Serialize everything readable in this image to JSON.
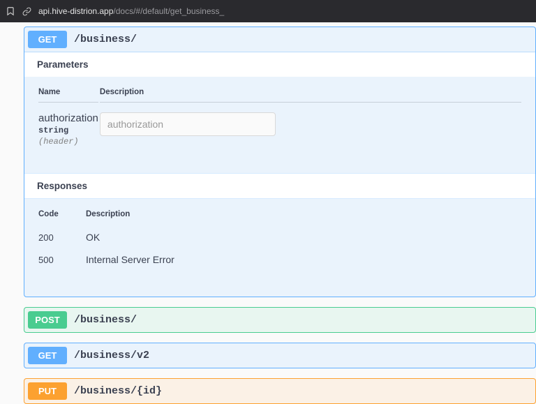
{
  "browser": {
    "url_host": "api.hive-distrion.app",
    "url_path": "/docs/#/default/get_business_"
  },
  "endpoints": {
    "get_business": {
      "method": "GET",
      "path": "/business/"
    },
    "post_business": {
      "method": "POST",
      "path": "/business/"
    },
    "get_business_v2": {
      "method": "GET",
      "path": "/business/v2"
    },
    "put_business_id": {
      "method": "PUT",
      "path": "/business/{id}"
    }
  },
  "detail": {
    "parameters_header": "Parameters",
    "responses_header": "Responses",
    "col_name": "Name",
    "col_description": "Description",
    "col_code": "Code",
    "params": [
      {
        "name": "authorization",
        "type": "string",
        "in": "(header)",
        "placeholder": "authorization"
      }
    ],
    "responses": [
      {
        "code": "200",
        "description": "OK"
      },
      {
        "code": "500",
        "description": "Internal Server Error"
      }
    ]
  }
}
